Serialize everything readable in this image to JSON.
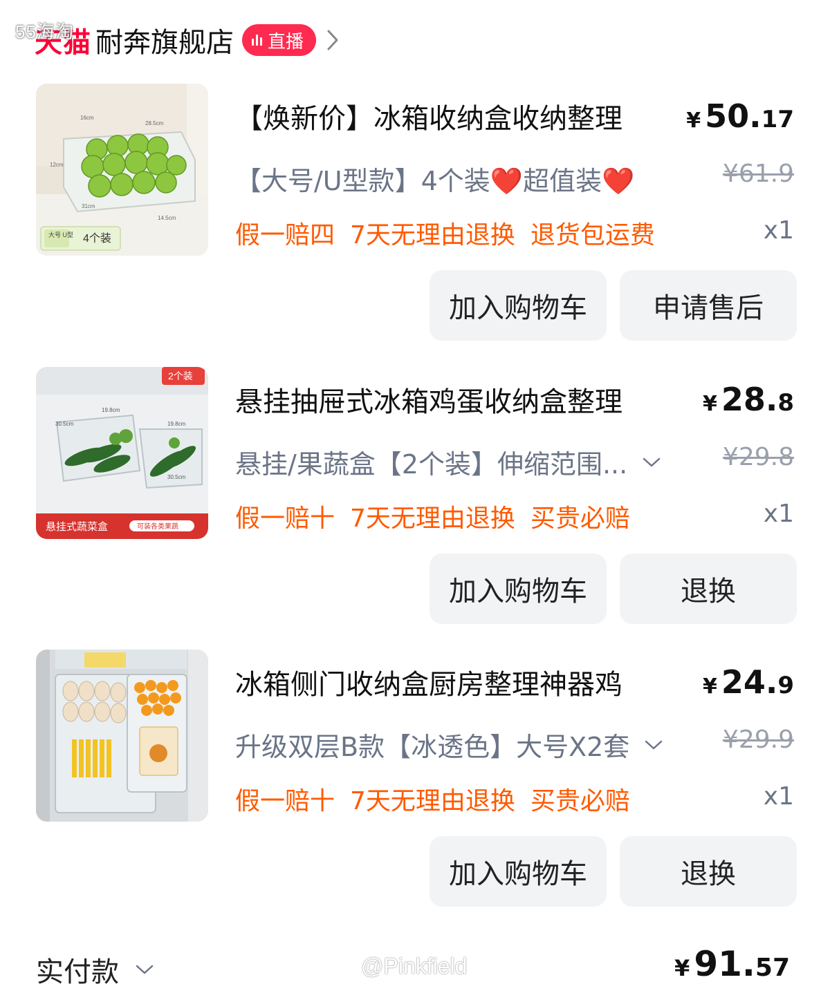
{
  "watermark_top": "55海淘",
  "shop": {
    "brand": "天猫",
    "name": "耐奔旗舰店",
    "live_label": "直播"
  },
  "items": [
    {
      "title": "【焕新价】冰箱收纳盒收纳整理",
      "price_currency": "¥",
      "price_int": "50.",
      "price_dec": "17",
      "variant": "【大号/U型款】4个装❤️超值装❤️",
      "orig_price": "¥61.9",
      "tags": [
        "假一赔四",
        "7天无理由退换",
        "退货包运费"
      ],
      "qty": "x1",
      "thumb": {
        "dims": [
          "16cm",
          "28.5cm",
          "12cm",
          "31cm",
          "14.5cm"
        ],
        "badge_a": "大号 U型",
        "badge_b": "4个装"
      },
      "btn_cart": "加入购物车",
      "btn_after": "申请售后"
    },
    {
      "title": "悬挂抽屉式冰箱鸡蛋收纳盒整理",
      "price_currency": "¥",
      "price_int": "28.",
      "price_dec": "8",
      "variant": "悬挂/果蔬盒【2个装】伸缩范围...",
      "orig_price": "¥29.8",
      "tags": [
        "假一赔十",
        "7天无理由退换",
        "买贵必赔"
      ],
      "qty": "x1",
      "thumb": {
        "corner": "2个装",
        "banner": "悬挂式蔬菜盒",
        "banner_pill": "可装各类果蔬",
        "dims": [
          "19.8cm",
          "30.5cm",
          "19.8cm",
          "30.5cm"
        ]
      },
      "btn_cart": "加入购物车",
      "btn_after": "退换"
    },
    {
      "title": "冰箱侧门收纳盒厨房整理神器鸡",
      "price_currency": "¥",
      "price_int": "24.",
      "price_dec": "9",
      "variant": "升级双层B款【冰透色】大号X2套",
      "orig_price": "¥29.9",
      "tags": [
        "假一赔十",
        "7天无理由退换",
        "买贵必赔"
      ],
      "qty": "x1",
      "thumb": {},
      "btn_cart": "加入购物车",
      "btn_after": "退换"
    }
  ],
  "footer": {
    "label": "实付款",
    "watermark": "@Pinkfield",
    "total_currency": "¥",
    "total_int": "91.",
    "total_dec": "57"
  },
  "colors": {
    "brand_red": "#ff0036",
    "live_badge": "#ff2a50",
    "tag_orange": "#ff5a00",
    "muted": "#6b7487",
    "button_bg": "#f2f3f5"
  },
  "icons": [
    "live-bars-icon",
    "chevron-right-icon",
    "chevron-down-icon"
  ]
}
